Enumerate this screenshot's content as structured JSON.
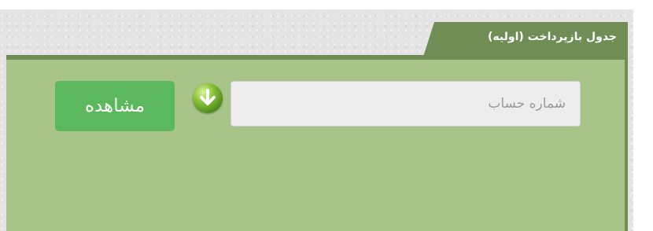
{
  "panel": {
    "tab_title": "جدول بازپرداخت (اولیه)"
  },
  "form": {
    "account_placeholder": "شماره حساب",
    "account_value": "",
    "download_icon": "arrow-down-circle-icon",
    "view_button_label": "مشاهده"
  },
  "colors": {
    "panel_bg": "#a8c489",
    "panel_border": "#6f8d55",
    "button_green": "#5cb85c",
    "page_bg": "#e4e4e4"
  }
}
